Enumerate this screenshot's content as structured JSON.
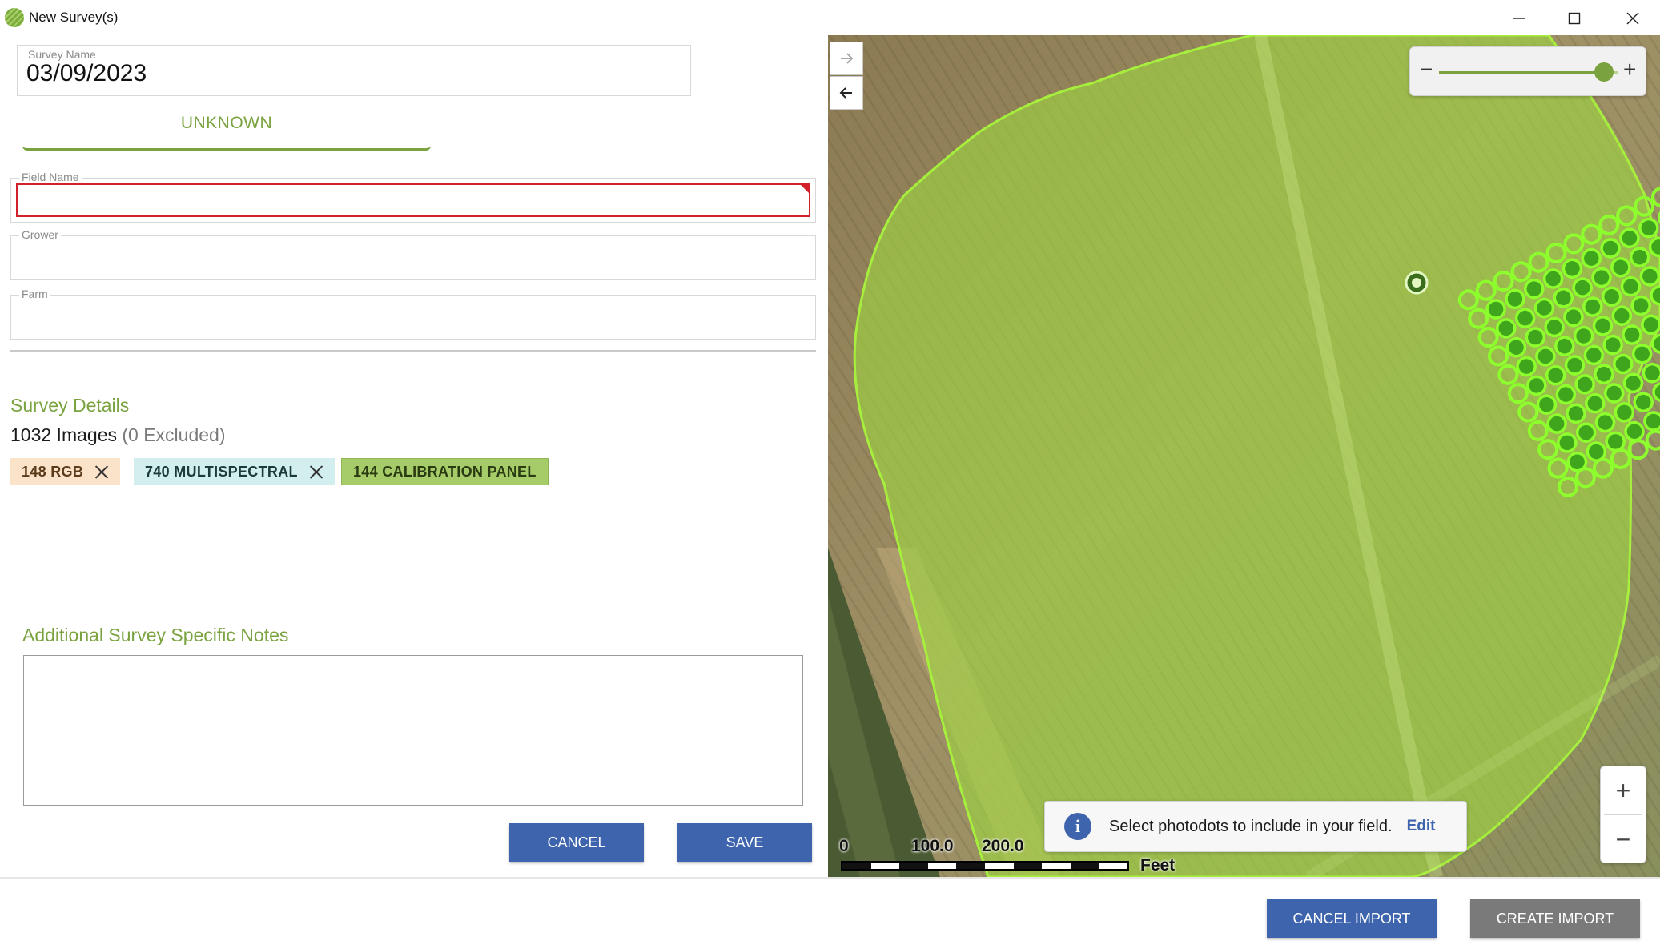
{
  "window": {
    "title": "New Survey(s)",
    "icon": "app-logo-icon"
  },
  "form": {
    "survey_name_label": "Survey Name",
    "survey_name_value": "03/09/2023",
    "tab_label": "UNKNOWN",
    "field_name_label": "Field Name",
    "field_name_value": "",
    "grower_label": "Grower",
    "grower_value": "",
    "farm_label": "Farm",
    "farm_value": ""
  },
  "details": {
    "title": "Survey Details",
    "images_count": "1032 Images",
    "images_excluded": "(0 Excluded)",
    "chips": [
      {
        "label": "148 RGB",
        "color": "#fbe3c9",
        "removable": true
      },
      {
        "label": "740 MULTISPECTRAL",
        "color": "#d2eeee",
        "removable": true
      },
      {
        "label": "144 CALIBRATION PANEL",
        "color": "#a6cc6a",
        "removable": false
      }
    ]
  },
  "notes": {
    "title": "Additional Survey Specific Notes",
    "value": ""
  },
  "actions": {
    "cancel_label": "CANCEL",
    "save_label": "SAVE"
  },
  "map": {
    "nav_forward_icon": "arrow-right-icon",
    "nav_back_icon": "arrow-left-icon",
    "slider_minus": "−",
    "slider_plus": "+",
    "zoom_level": 0.92,
    "zoom_in": "+",
    "zoom_out": "−",
    "scale": {
      "labels": [
        "0",
        "100.0",
        "200.0"
      ],
      "unit": "Feet"
    },
    "info_message": "Select photodots to include in your field.",
    "info_edit": "Edit",
    "field_color": "#9ed640",
    "dot_color": "#3fa51d"
  },
  "footer": {
    "cancel_import_label": "CANCEL IMPORT",
    "create_import_label": "CREATE IMPORT"
  },
  "colors": {
    "accent_green": "#7aa33f",
    "primary_blue": "#3d64ad",
    "error_red": "#d4202b",
    "disabled_grey": "#7a7a7a"
  }
}
